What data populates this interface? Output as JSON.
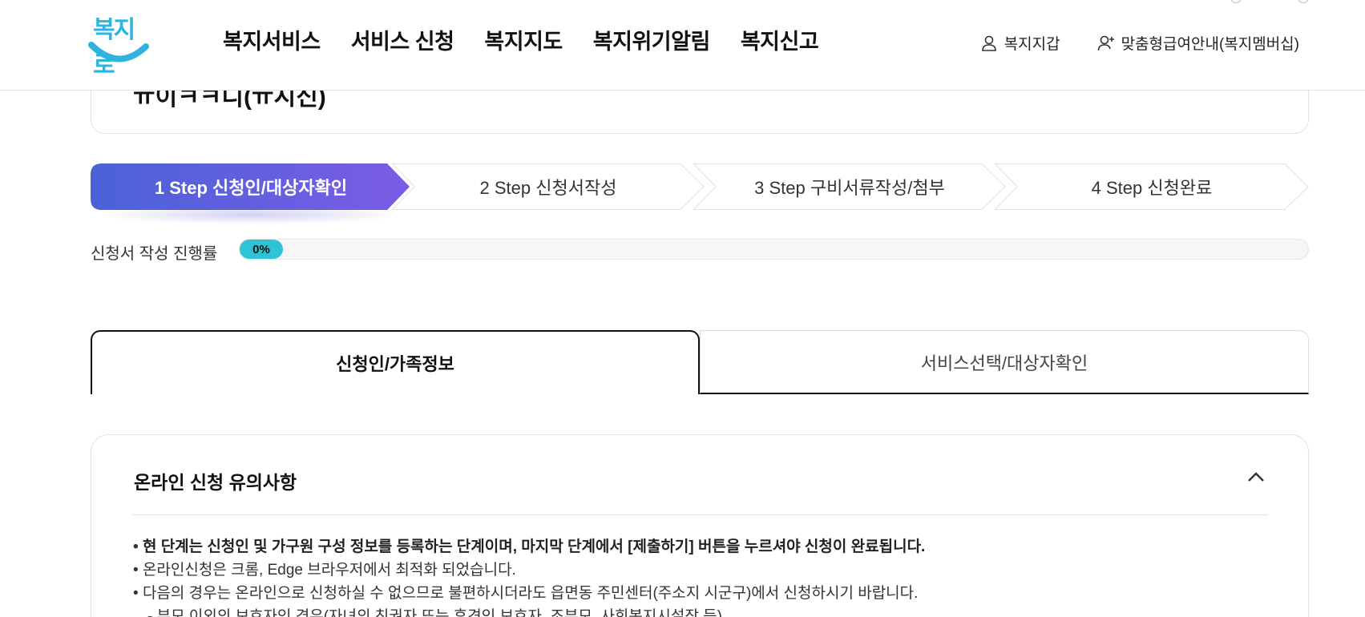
{
  "header": {
    "logo_text": "복지로",
    "nav": [
      "복지서비스",
      "서비스 신청",
      "복지지도",
      "복지위기알림",
      "복지신고"
    ],
    "util": {
      "wallet": "복지지갑",
      "membership": "맞춤형급여안내(복지멤버십)"
    }
  },
  "title_card": {
    "partial_title": "ㅠ이ㅋㅋ디(ㅠ시신)"
  },
  "steps": [
    {
      "label": "1 Step 신청인/대상자확인",
      "active": true
    },
    {
      "label": "2 Step 신청서작성",
      "active": false
    },
    {
      "label": "3 Step 구비서류작성/첨부",
      "active": false
    },
    {
      "label": "4 Step 신청완료",
      "active": false
    }
  ],
  "colors": {
    "step_gradient_start": "#4a62d8",
    "step_gradient_end": "#7b5ce6",
    "progress": "#2ec4d6",
    "logo": "#2fb4e0"
  },
  "progress": {
    "label": "신청서 작성 진행률",
    "value_text": "0%",
    "value": 0
  },
  "tabs": [
    {
      "label": "신청인/가족정보",
      "active": true
    },
    {
      "label": "서비스선택/대상자확인",
      "active": false
    }
  ],
  "notice": {
    "title": "온라인 신청 유의사항",
    "toggle_icon": "chevron-up-icon",
    "items": [
      "현 단계는 신청인 및 가구원 구성 정보를 등록하는 단계이며, 마지막 단계에서 [제출하기] 버튼을 누르셔야 신청이 완료됩니다.",
      "온라인신청은 크롬, Edge 브라우저에서 최적화 되었습니다.",
      "다음의 경우는 온라인으로 신청하실 수 없으므로 불편하시더라도 읍면동 주민센터(주소지 시군구)에서 신청하시기 바랍니다.",
      "부모 이외의 보호자인 경우(자녀의 친권자 또는 후견인 보호자, 조부모, 사회복지시설장 등)"
    ]
  }
}
